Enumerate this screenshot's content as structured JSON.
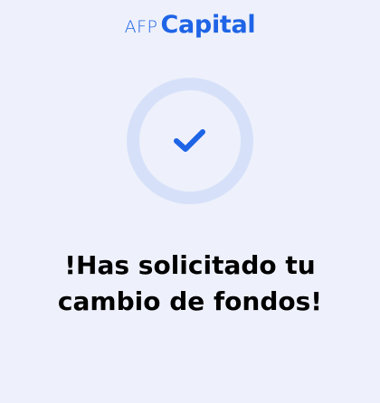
{
  "brand": {
    "prefix": "AFP",
    "name": "Capital",
    "color": "#1e64e6"
  },
  "status": {
    "icon": "checkmark-icon",
    "ring_color": "#d6e1f9",
    "check_color": "#1e64e6"
  },
  "message": {
    "line1": "!Has solicitado tu",
    "line2": "cambio de fondos!"
  },
  "background_color": "#eef1fb"
}
